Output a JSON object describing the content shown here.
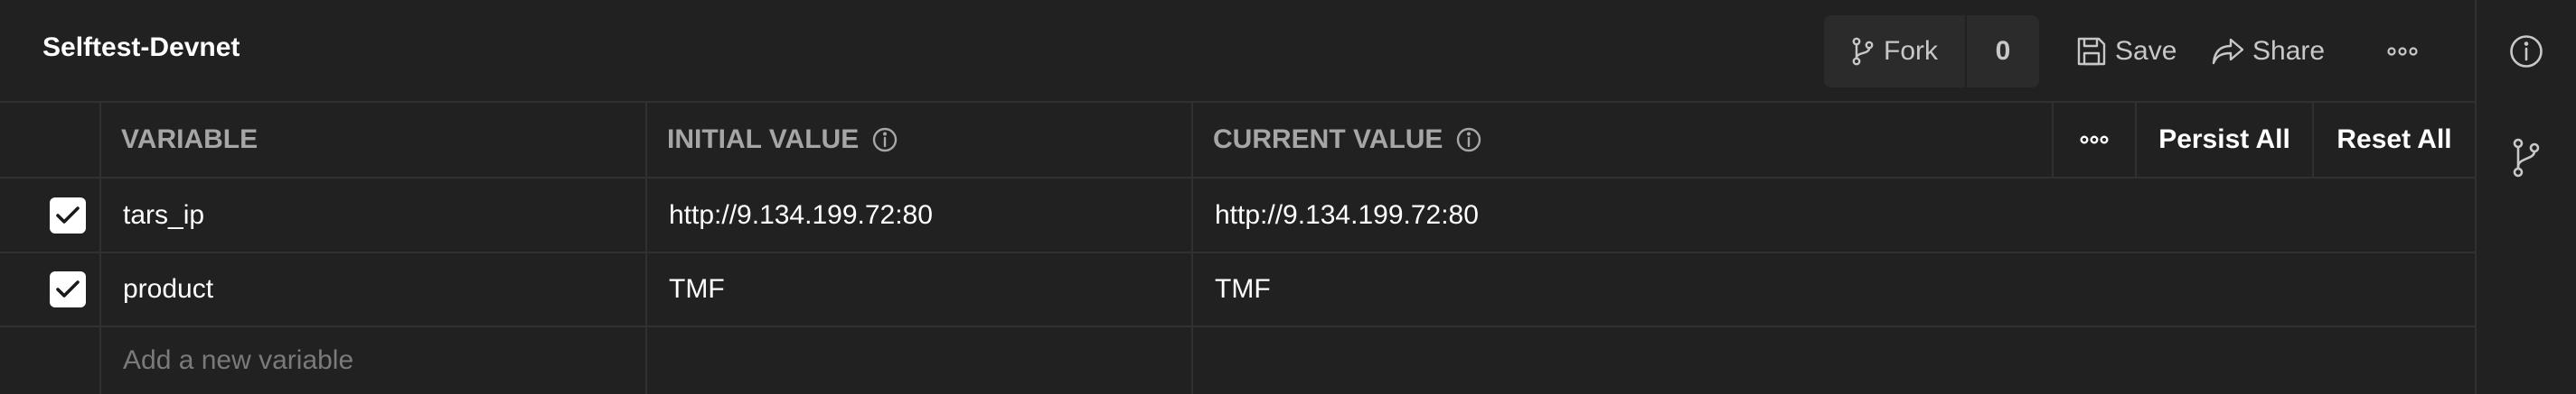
{
  "header": {
    "title": "Selftest-Devnet",
    "fork_label": "Fork",
    "fork_count": "0",
    "save_label": "Save",
    "share_label": "Share",
    "more_icon": "more-horizontal-icon"
  },
  "table": {
    "columns": {
      "variable": "VARIABLE",
      "initial_value": "INITIAL VALUE",
      "current_value": "CURRENT VALUE"
    },
    "actions": {
      "more_icon": "more-horizontal-icon",
      "persist_all": "Persist All",
      "reset_all": "Reset All"
    },
    "rows": [
      {
        "checked": true,
        "variable": "tars_ip",
        "initial_value": "http://9.134.199.72:80",
        "current_value": "http://9.134.199.72:80"
      },
      {
        "checked": true,
        "variable": "product",
        "initial_value": "TMF",
        "current_value": "TMF"
      }
    ],
    "new_variable_placeholder": "Add a new variable"
  },
  "right_sidebar": {
    "icons": [
      "info-icon",
      "fork-icon"
    ]
  },
  "colors": {
    "background": "#212121",
    "border": "#303030",
    "button_bg": "#2b2b2b",
    "muted_text": "#a6a6a6",
    "placeholder_text": "#7a7a7a"
  }
}
